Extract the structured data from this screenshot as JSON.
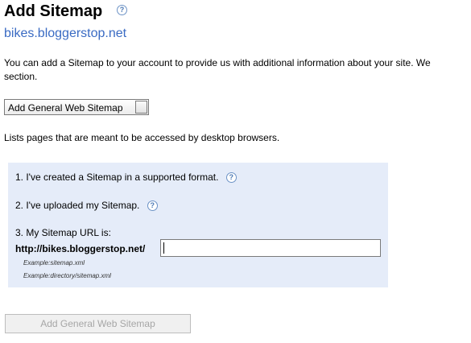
{
  "header": {
    "title": "Add Sitemap",
    "help_glyph": "?",
    "site": "bikes.bloggerstop.net"
  },
  "intro": "You can add a Sitemap to your account to provide us with additional information about your site. We",
  "intro_line2": "section.",
  "sitemap_type": {
    "selected": "Add General Web Sitemap"
  },
  "type_description": "Lists pages that are meant to be accessed by desktop browsers.",
  "steps": [
    {
      "label": "1. I've created a Sitemap in a supported format.",
      "help_glyph": "?"
    },
    {
      "label": "2. I've uploaded my Sitemap.",
      "help_glyph": "?"
    },
    {
      "label": "3. My Sitemap URL is:"
    }
  ],
  "url": {
    "prefix": "http://bikes.bloggerstop.net/",
    "value": "",
    "examples": [
      "Example:sitemap.xml",
      "Example:directory/sitemap.xml"
    ]
  },
  "submit_label": "Add General Web Sitemap",
  "colors": {
    "panel_bg": "#e5ecf9",
    "link": "#3a6bc3",
    "disabled_text": "#a6a6a6"
  },
  "icons": [
    "help-icon",
    "dropdown-arrow-icon"
  ]
}
